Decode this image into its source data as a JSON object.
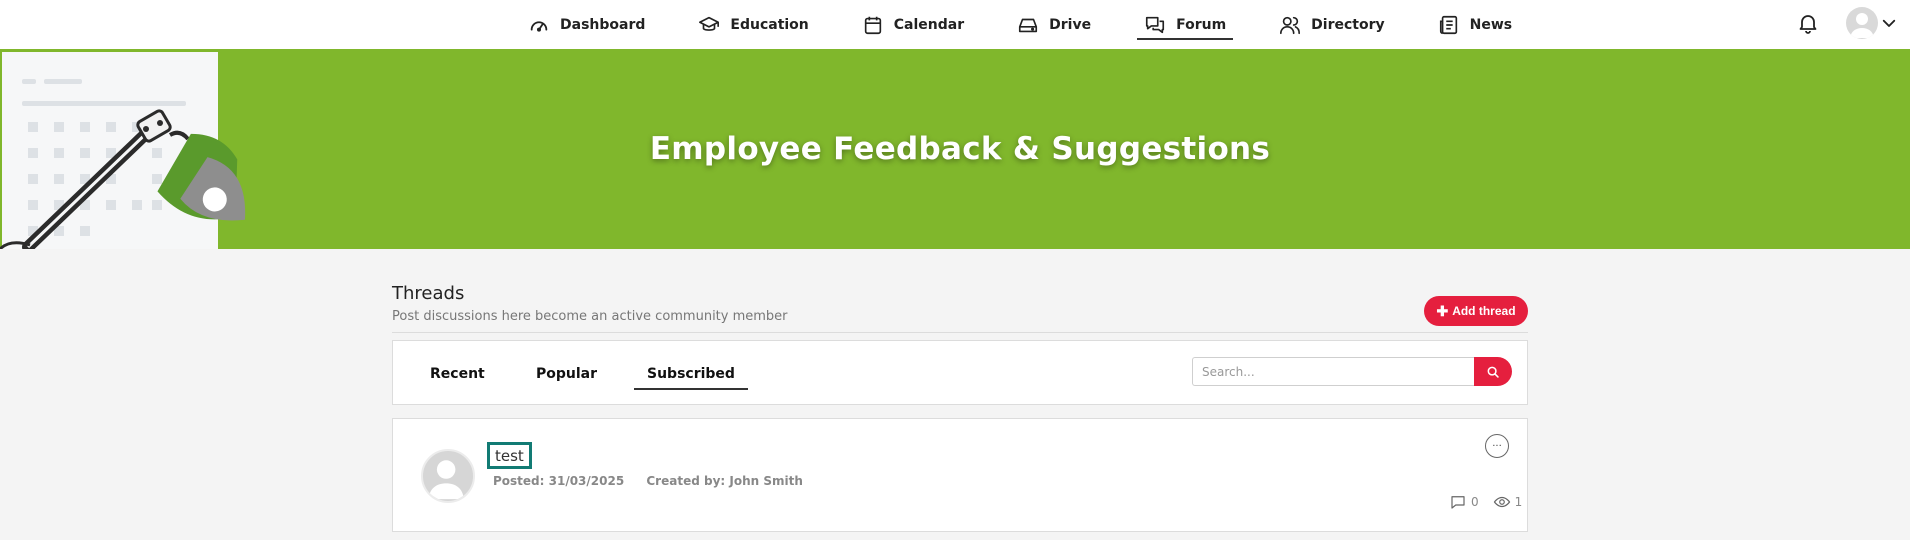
{
  "nav": {
    "items": [
      {
        "label": "Dashboard",
        "icon": "gauge-icon"
      },
      {
        "label": "Education",
        "icon": "graduation-cap-icon"
      },
      {
        "label": "Calendar",
        "icon": "calendar-icon"
      },
      {
        "label": "Drive",
        "icon": "drive-icon"
      },
      {
        "label": "Forum",
        "icon": "chat-icon",
        "active": true
      },
      {
        "label": "Directory",
        "icon": "people-icon"
      },
      {
        "label": "News",
        "icon": "newspaper-icon"
      }
    ]
  },
  "banner": {
    "title": "Employee Feedback & Suggestions",
    "color": "#80b72c"
  },
  "threads": {
    "title": "Threads",
    "subtitle": "Post discussions here become an active community member",
    "add_label": "Add thread"
  },
  "tabs": [
    {
      "label": "Recent"
    },
    {
      "label": "Popular"
    },
    {
      "label": "Subscribed",
      "active": true
    }
  ],
  "search": {
    "placeholder": "Search..."
  },
  "thread": {
    "title": "test",
    "posted": "Posted: 31/03/2025",
    "created_by": "Created by: John Smith",
    "comments": "0",
    "views": "1"
  },
  "colors": {
    "accent": "#e51f3e",
    "banner": "#80b72c",
    "focus": "#127b74"
  }
}
